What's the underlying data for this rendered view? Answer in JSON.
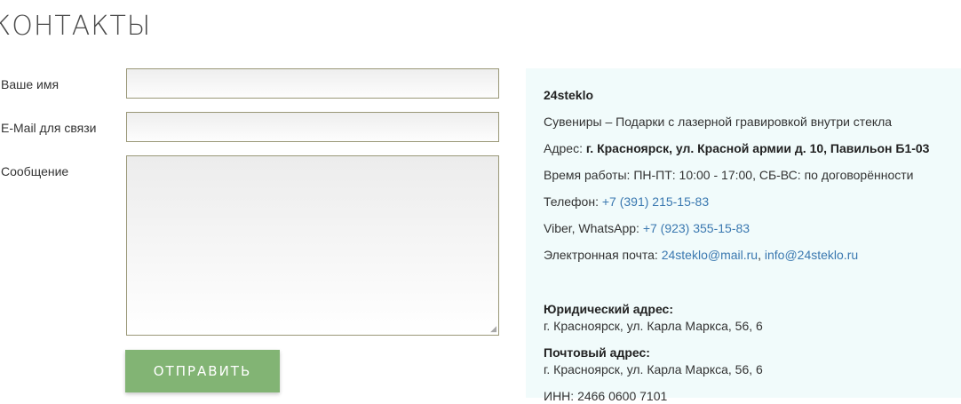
{
  "page": {
    "title": "КОНТАКТЫ"
  },
  "form": {
    "name_label": "Ваше имя",
    "name_value": "",
    "email_label": "E-Mail для связи",
    "email_value": "",
    "message_label": "Сообщение",
    "message_value": "",
    "submit_label": "ОТПРАВИТЬ"
  },
  "info": {
    "company_name": "24steklo",
    "tagline": "Сувениры – Подарки с лазерной гравировкой внутри стекла",
    "address_label": "Адрес: ",
    "address_value": "г. Красноярск, ул. Красной армии д. 10, Павильон Б1-03",
    "hours": "Время работы: ПН-ПТ: 10:00 - 17:00, СБ-ВС: по договорённости",
    "phone_label": "Телефон: ",
    "phone_value": "+7 (391) 215-15-83",
    "messenger_label": "Viber, WhatsApp: ",
    "messenger_value": "+7 (923) 355-15-83",
    "email_label": "Электронная почта: ",
    "email_primary": "24steklo@mail.ru",
    "email_separator": ", ",
    "email_secondary": "info@24steklo.ru",
    "legal_address_label": "Юридический адрес:",
    "legal_address_value": "г. Красноярск,  ул. Карла Маркса, 56, 6",
    "postal_address_label": "Почтовый адрес:",
    "postal_address_value": "г. Красноярск, ул. Карла Маркса, 56, 6",
    "inn": "ИНН: 2466 0600 7101"
  },
  "colors": {
    "accent_button": "#82b474",
    "link": "#3a78b0",
    "panel_background": "#f1fbfb",
    "field_border": "#9a9878"
  }
}
